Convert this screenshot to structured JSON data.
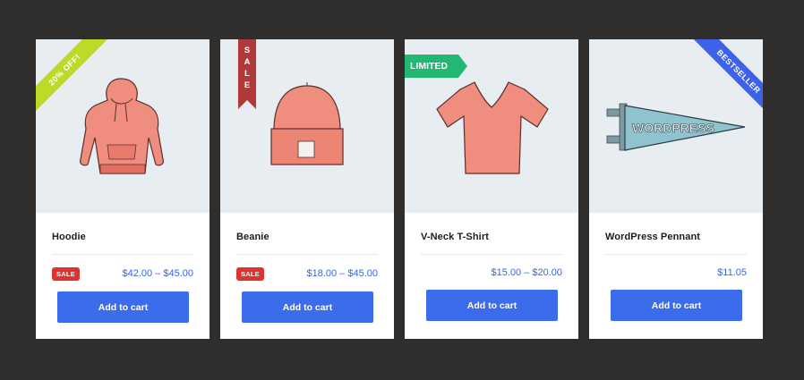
{
  "products": [
    {
      "title": "Hoodie",
      "badge": "20% OFF!",
      "sale_label": "SALE",
      "price": "$42.00 – $45.00",
      "button": "Add to cart"
    },
    {
      "title": "Beanie",
      "badge_letters": [
        "S",
        "A",
        "L",
        "E"
      ],
      "sale_label": "SALE",
      "price": "$18.00 – $45.00",
      "button": "Add to cart"
    },
    {
      "title": "V-Neck T-Shirt",
      "badge": "LIMITED",
      "price": "$15.00 – $20.00",
      "button": "Add to cart"
    },
    {
      "title": "WordPress Pennant",
      "badge": "BESTSELLER",
      "price": "$11.05",
      "button": "Add to cart",
      "pennant_text": "WORDPRESS"
    }
  ],
  "colors": {
    "accent": "#3a6ceb",
    "price": "#3467e6",
    "sale": "#e0332f",
    "limited": "#22b872",
    "bestseller": "#3d62e8",
    "discount": "#bfd92a"
  }
}
